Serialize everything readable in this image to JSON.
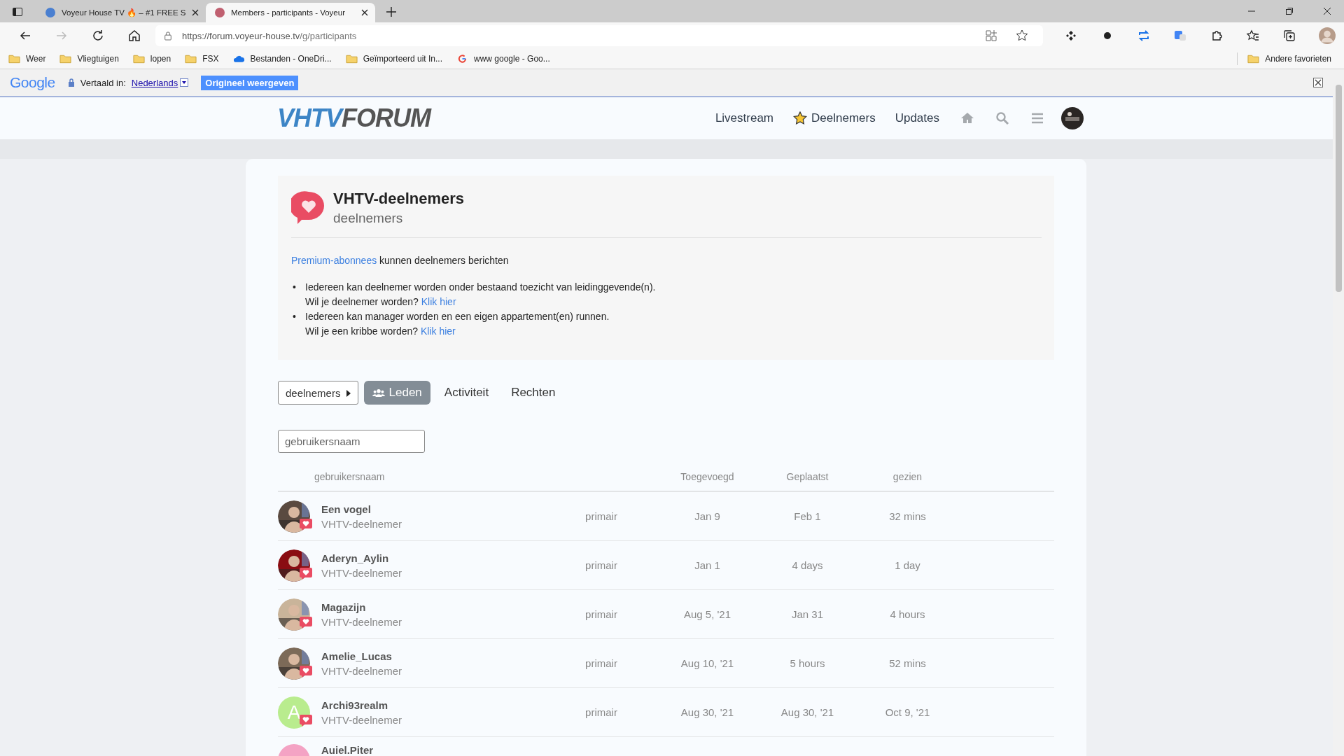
{
  "browser": {
    "tabs": [
      {
        "title": "Voyeur House TV 🔥 – #1 FREE S",
        "selected": false
      },
      {
        "title": "Members - participants - Voyeur",
        "selected": true
      }
    ],
    "url_host": "https://forum.voyeur-house.tv",
    "url_path": "/g/participants",
    "bookmarks": [
      {
        "label": "Weer",
        "kind": "folder"
      },
      {
        "label": "Vliegtuigen",
        "kind": "folder"
      },
      {
        "label": "lopen",
        "kind": "folder"
      },
      {
        "label": "FSX",
        "kind": "folder"
      },
      {
        "label": "Bestanden - OneDri...",
        "kind": "cloud"
      },
      {
        "label": "Geïmporteerd uit In...",
        "kind": "folder"
      },
      {
        "label": "www google - Goo...",
        "kind": "google"
      }
    ],
    "other_favorites": "Andere favorieten"
  },
  "translate_bar": {
    "brand": "Google",
    "label": "Vertaald in:",
    "language": "Nederlands",
    "button": "Origineel weergeven"
  },
  "site": {
    "logo_a": "VHTV",
    "logo_b": "FORUM",
    "nav": [
      {
        "label": "Livestream",
        "kind": "plain"
      },
      {
        "label": "Deelnemers",
        "kind": "star"
      },
      {
        "label": "Updates",
        "kind": "plain"
      }
    ]
  },
  "group": {
    "title": "VHTV-deelnemers",
    "subtitle": "deelnemers",
    "intro_link": "Premium-abonnees",
    "intro_text": " kunnen deelnemers berichten",
    "bullets": [
      {
        "marker": "•",
        "text": "Iedereen kan deelnemer worden onder bestaand toezicht van leidinggevende(n).",
        "question": "Wil je deelnemer worden?",
        "link": "Klik hier"
      },
      {
        "marker": "•",
        "text": "Iedereen kan manager worden en een eigen appartement(en) runnen.",
        "question": "Wil je een kribbe worden?",
        "link": "Klik hier"
      }
    ]
  },
  "group_tabs": {
    "dropdown": "deelnemers",
    "tabs": [
      {
        "label": "Leden",
        "selected": true
      },
      {
        "label": "Activiteit",
        "selected": false
      },
      {
        "label": "Rechten",
        "selected": false
      }
    ]
  },
  "search": {
    "placeholder": "gebruikersnaam"
  },
  "columns": [
    "gebruikersnaam",
    "Toegevoegd",
    "Geplaatst",
    "gezien"
  ],
  "members": [
    {
      "name": "Een vogel",
      "title": "VHTV-deelnemer",
      "type": "primair",
      "added": "Jan 9",
      "posted": "Feb 1",
      "seen": "32 mins"
    },
    {
      "name": "Aderyn_Aylin",
      "title": "VHTV-deelnemer",
      "type": "primair",
      "added": "Jan 1",
      "posted": "4 days",
      "seen": "1 day"
    },
    {
      "name": "Magazijn",
      "title": "VHTV-deelnemer",
      "type": "primair",
      "added": "Aug 5, '21",
      "posted": "Jan 31",
      "seen": "4 hours"
    },
    {
      "name": "Amelie_Lucas",
      "title": "VHTV-deelnemer",
      "type": "primair",
      "added": "Aug 10, '21",
      "posted": "5 hours",
      "seen": "52 mins"
    },
    {
      "name": "Archi93realm",
      "title": "VHTV-deelnemer",
      "type": "primair",
      "added": "Aug 30, '21",
      "posted": "Aug 30, '21",
      "seen": "Oct 9, '21",
      "avatar": {
        "kind": "letter",
        "letter": "A",
        "color": "#b9ec8e"
      }
    },
    {
      "name": "Auiel.Piter",
      "avatar": {
        "kind": "letter",
        "color": "#f4a3c4"
      }
    }
  ]
}
